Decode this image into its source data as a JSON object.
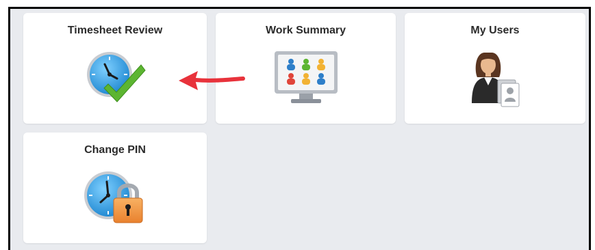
{
  "tiles": {
    "timesheet_review": {
      "label": "Timesheet Review",
      "icon": "clock-check-icon"
    },
    "work_summary": {
      "label": "Work Summary",
      "icon": "monitor-people-icon"
    },
    "my_users": {
      "label": "My Users",
      "icon": "user-card-icon"
    },
    "change_pin": {
      "label": "Change PIN",
      "icon": "clock-lock-icon"
    }
  },
  "annotation": {
    "icon": "red-arrow-icon",
    "color": "#e8323b"
  },
  "colors": {
    "background": "#e9ebef",
    "tile": "#ffffff",
    "title_text": "#2b2b2b",
    "clock_blue": "#2e9be0",
    "check_green": "#5cb531",
    "lock_orange": "#f19540"
  }
}
